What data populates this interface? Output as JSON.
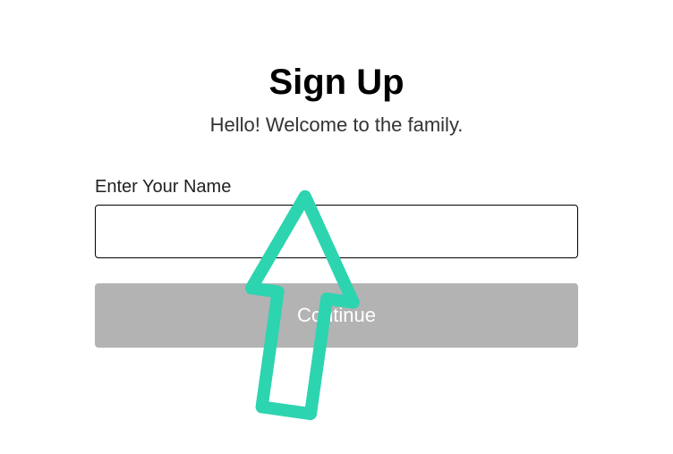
{
  "form": {
    "title": "Sign Up",
    "subtitle": "Hello! Welcome to the family.",
    "name_label": "Enter Your Name",
    "name_value": "",
    "continue_label": "Continue"
  },
  "annotation": {
    "arrow_color": "#2dd4b0"
  }
}
